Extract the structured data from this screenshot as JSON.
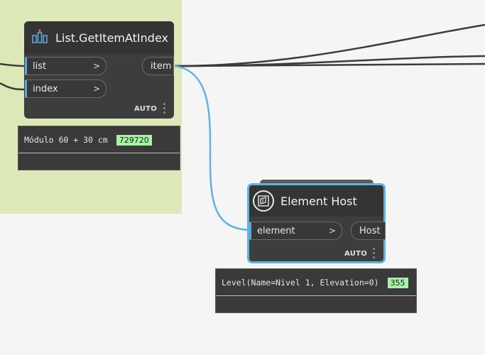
{
  "nodes": {
    "get_item": {
      "title": "List.GetItemAtIndex",
      "inputs": [
        "list",
        "index"
      ],
      "output": "item",
      "lacing": "AUTO",
      "preview": {
        "text": "Módulo 60 + 30 cm",
        "value": "729720"
      }
    },
    "element_host": {
      "title": "Element Host",
      "input": "element",
      "output": "Host",
      "lacing": "AUTO",
      "preview": {
        "text": "Level(Name=Nivel 1, Elevation=0)",
        "value": "355"
      }
    }
  },
  "ports": {
    "chevron": ">"
  },
  "colors": {
    "canvas": "#f5f5f5",
    "group": "#dce8b8",
    "node": "#3d3d3d",
    "selected": "#5ab5e1",
    "wire": "#3c3c3c",
    "wire_selected": "#5ab5e1",
    "value_badge": "#a6f3a6"
  },
  "icons": [
    "list-get-item-icon",
    "element-host-icon",
    "node-menu-icon"
  ]
}
